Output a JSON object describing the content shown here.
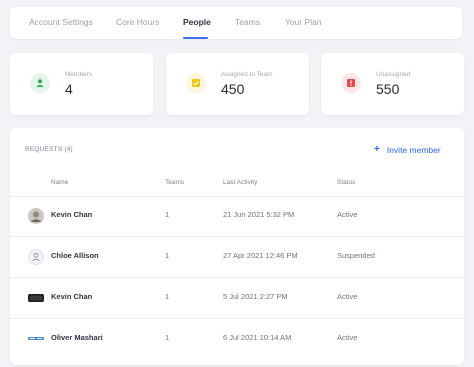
{
  "tabs": [
    {
      "label": "Account Settings"
    },
    {
      "label": "Core Hours"
    },
    {
      "label": "People"
    },
    {
      "label": "Teams"
    },
    {
      "label": "Your Plan"
    }
  ],
  "active_tab": "People",
  "stats": {
    "members": {
      "label": "Members",
      "value": "4",
      "icon": "user-icon",
      "color": "#2fa84f"
    },
    "assigned": {
      "label": "Assigned to Team",
      "value": "450",
      "icon": "check-icon",
      "color": "#f0c419"
    },
    "unassigned": {
      "label": "Unassigned",
      "value": "550",
      "icon": "alert-icon",
      "color": "#e5484d"
    }
  },
  "requests": {
    "title": "REQUESTS (4)",
    "invite_label": "Invite member",
    "columns": {
      "name": "Name",
      "teams": "Teams",
      "activity": "Last Activity",
      "status": "Status"
    },
    "rows": [
      {
        "name": "Kevin Chan",
        "teams": "1",
        "activity": "21 Jun 2021 5:32 PM",
        "status": "Active"
      },
      {
        "name": "Chloe Allison",
        "teams": "1",
        "activity": "27 Apr 2021 12:46 PM",
        "status": "Suspended"
      },
      {
        "name": "Kevin Chan",
        "teams": "1",
        "activity": "5 Jul 2021 2:27 PM",
        "status": "Active"
      },
      {
        "name": "Oliver Mashari",
        "teams": "1",
        "activity": "6 Jul 2021 10:14 AM",
        "status": "Active"
      }
    ]
  },
  "colors": {
    "accent": "#3a6ff0",
    "link": "#2f64e8"
  }
}
